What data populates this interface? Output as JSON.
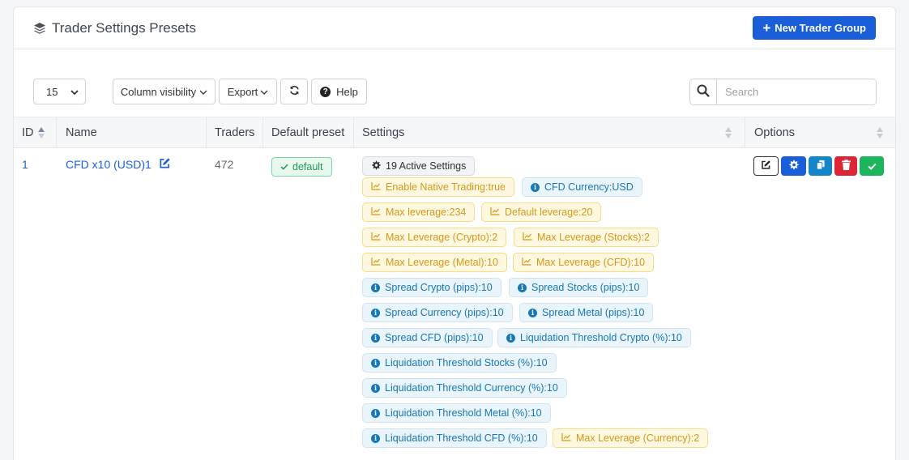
{
  "header": {
    "title": "Trader Settings Presets",
    "new_button": "New Trader Group"
  },
  "toolbar": {
    "page_length": "15",
    "column_visibility": "Column visibility",
    "export": "Export",
    "help": "Help",
    "search_placeholder": "Search"
  },
  "table": {
    "columns": [
      "ID",
      "Name",
      "Traders",
      "Default preset",
      "Settings",
      "Options"
    ],
    "row": {
      "id": "1",
      "name": "CFD x10 (USD)1",
      "traders": "472",
      "default_badge": "default",
      "settings": [
        {
          "type": "dark",
          "text": "19 Active Settings"
        },
        {
          "type": "warn",
          "text": "Enable Native Trading:true"
        },
        {
          "type": "info",
          "text": "CFD Currency:USD"
        },
        {
          "type": "warn",
          "text": "Max leverage:234"
        },
        {
          "type": "warn",
          "text": "Default leverage:20"
        },
        {
          "type": "warn",
          "text": "Max Leverage (Crypto):2"
        },
        {
          "type": "warn",
          "text": "Max Leverage (Stocks):2"
        },
        {
          "type": "warn",
          "text": "Max Leverage (Metal):10"
        },
        {
          "type": "warn",
          "text": "Max Leverage (CFD):10"
        },
        {
          "type": "info",
          "text": "Spread Crypto (pips):10"
        },
        {
          "type": "info",
          "text": "Spread Stocks (pips):10"
        },
        {
          "type": "info",
          "text": "Spread Currency (pips):10"
        },
        {
          "type": "info",
          "text": "Spread Metal (pips):10"
        },
        {
          "type": "info",
          "text": "Spread CFD (pips):10"
        },
        {
          "type": "info",
          "text": "Liquidation Threshold Crypto (%):10"
        },
        {
          "type": "info",
          "text": "Liquidation Threshold Stocks (%):10"
        },
        {
          "type": "info",
          "text": "Liquidation Threshold Currency (%):10"
        },
        {
          "type": "info",
          "text": "Liquidation Threshold Metal (%):10"
        },
        {
          "type": "info",
          "text": "Liquidation Threshold CFD (%):10"
        },
        {
          "type": "warn",
          "text": "Max Leverage (Currency):2"
        }
      ]
    }
  },
  "colors": {
    "primary": "#1a5fd9",
    "info": "#1678b6",
    "warning": "#d49817",
    "danger": "#dc2535",
    "success": "#1bb55c"
  }
}
